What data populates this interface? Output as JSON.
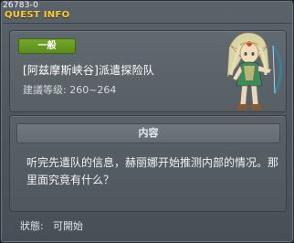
{
  "window": {
    "quest_id": "26783-0",
    "title": "QUEST INFO"
  },
  "quest": {
    "category_badge": "一般",
    "name": "[阿兹摩斯峡谷]派遣探险队",
    "level_text": "建議等级: 260~264",
    "portrait_icon": "elf-npc-portrait-icon"
  },
  "content": {
    "header": "内容",
    "text": "听完先遣队的信息，赫丽娜开始推测内部的情况。那里面究竟有什么？"
  },
  "status": {
    "label": "狀態:",
    "value": "可開始"
  },
  "colors": {
    "title": "#ffcc33",
    "badge": "#6a9c22",
    "panel": "#5a6269"
  }
}
